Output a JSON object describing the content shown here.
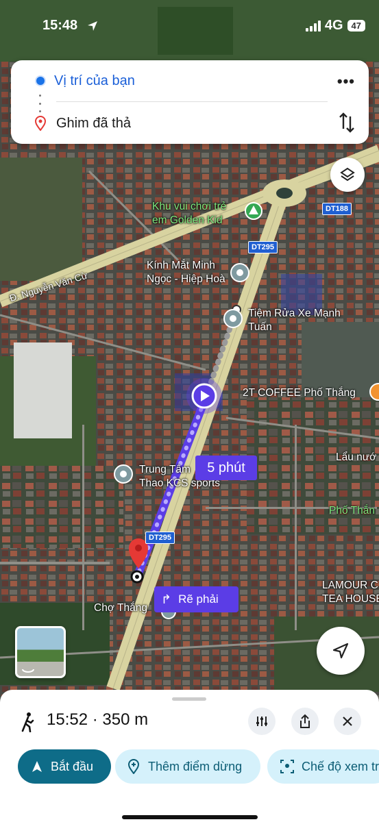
{
  "status_bar": {
    "time": "15:48",
    "network": "4G",
    "battery": "47"
  },
  "directions": {
    "origin": "Vị trí của bạn",
    "destination": "Ghim đã thả"
  },
  "map": {
    "pois": [
      {
        "name": "Khu vui chơi trẻ\nem Golden Kid",
        "kind": "park",
        "color": "#34a853"
      },
      {
        "name": "Kính Mắt Minh\nNgọc - Hiệp Hoà",
        "kind": "place"
      },
      {
        "name": "Tiệm Rửa Xe Mạnh\nTuấn",
        "kind": "place"
      },
      {
        "name": "2T COFFEE Phố Thắng",
        "kind": "cafe"
      },
      {
        "name": "Trung Tâm\nThao KCS sports",
        "kind": "place"
      },
      {
        "name": "Lẩu nướ",
        "kind": "food"
      },
      {
        "name": "Phố Thắn",
        "kind": "area",
        "color": "#7ee87e"
      },
      {
        "name": "LAMOUR C\nTEA HOUSE H",
        "kind": "place"
      },
      {
        "name": "Chợ Thắng",
        "kind": "market"
      }
    ],
    "road_labels": [
      "Đ. Nguyễn Văn Cừ"
    ],
    "shields": [
      "DT188",
      "DT295",
      "DT295"
    ],
    "eta_label": "5 phút",
    "turn_instruction": "Rẽ phải",
    "route_color": "#5b3de6"
  },
  "trip": {
    "mode_icon": "walking-icon",
    "summary": "15:52 · 350 m"
  },
  "actions": {
    "start": "Bắt đầu",
    "add_stop": "Thêm điểm dừng",
    "view_mode": "Chế độ xem tr"
  }
}
